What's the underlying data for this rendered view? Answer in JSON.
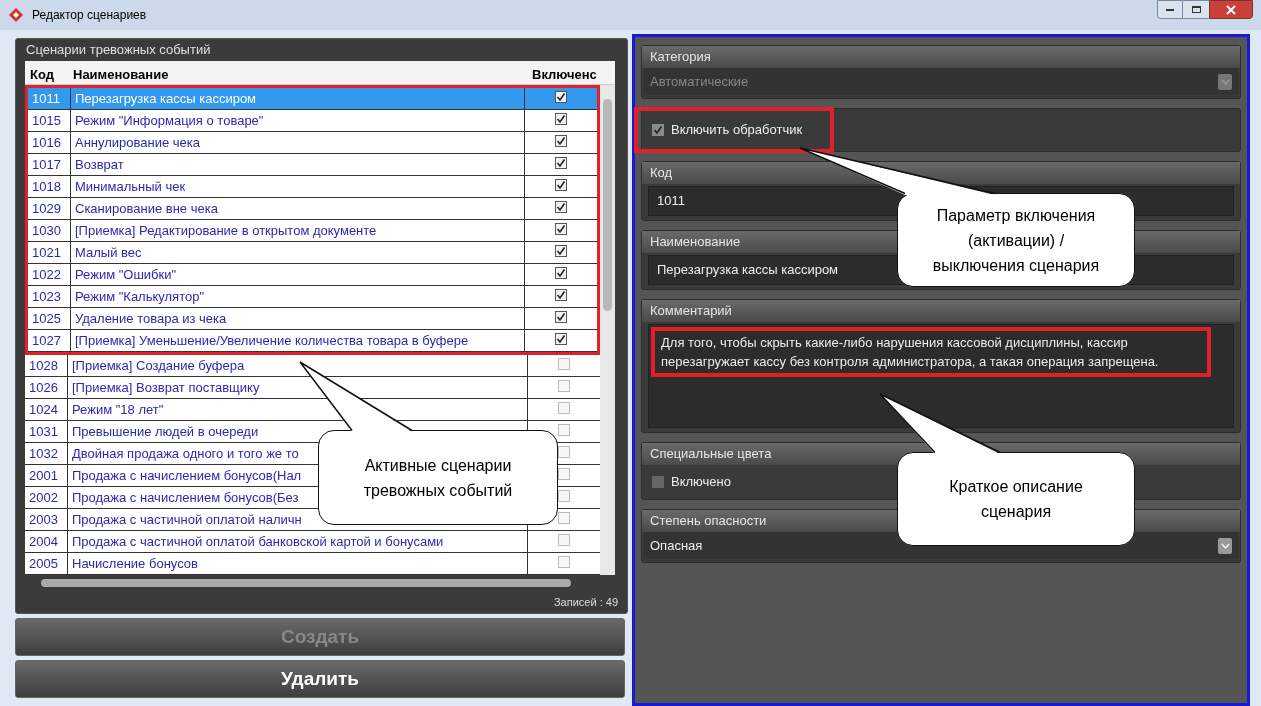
{
  "window": {
    "title": "Редактор сценариев"
  },
  "scenarios": {
    "title": "Сценарии тревожных событий",
    "columns": [
      "Код",
      "Наименование",
      "Включенс"
    ],
    "rows": [
      {
        "code": "1011",
        "name": "Перезагрузка кассы кассиром",
        "enabled": true,
        "selected": true
      },
      {
        "code": "1015",
        "name": "Режим \"Информация о товаре\"",
        "enabled": true,
        "selected": false
      },
      {
        "code": "1016",
        "name": "Аннулирование чека",
        "enabled": true,
        "selected": false
      },
      {
        "code": "1017",
        "name": "Возврат",
        "enabled": true,
        "selected": false
      },
      {
        "code": "1018",
        "name": "Минимальный чек",
        "enabled": true,
        "selected": false
      },
      {
        "code": "1029",
        "name": "Сканирование вне чека",
        "enabled": true,
        "selected": false
      },
      {
        "code": "1030",
        "name": "[Приемка] Редактирование в открытом документе",
        "enabled": true,
        "selected": false
      },
      {
        "code": "1021",
        "name": "Малый вес",
        "enabled": true,
        "selected": false
      },
      {
        "code": "1022",
        "name": "Режим \"Ошибки\"",
        "enabled": true,
        "selected": false
      },
      {
        "code": "1023",
        "name": "Режим \"Калькулятор\"",
        "enabled": true,
        "selected": false
      },
      {
        "code": "1025",
        "name": "Удаление товара из чека",
        "enabled": true,
        "selected": false
      },
      {
        "code": "1027",
        "name": "[Приемка] Уменьшение/Увеличение количества товара в буфере",
        "enabled": true,
        "selected": false
      },
      {
        "code": "1028",
        "name": "[Приемка] Создание буфера",
        "enabled": false,
        "selected": false
      },
      {
        "code": "1026",
        "name": "[Приемка] Возврат поставщику",
        "enabled": false,
        "selected": false
      },
      {
        "code": "1024",
        "name": "Режим \"18 лет\"",
        "enabled": false,
        "selected": false
      },
      {
        "code": "1031",
        "name": "Превышение людей в очереди",
        "enabled": false,
        "selected": false
      },
      {
        "code": "1032",
        "name": "Двойная продажа одного и того же то",
        "enabled": false,
        "selected": false
      },
      {
        "code": "2001",
        "name": "Продажа с начислением бонусов(Нал",
        "enabled": false,
        "selected": false
      },
      {
        "code": "2002",
        "name": "Продажа с начислением бонусов(Без",
        "enabled": false,
        "selected": false
      },
      {
        "code": "2003",
        "name": "Продажа с частичной оплатой наличн",
        "enabled": false,
        "selected": false
      },
      {
        "code": "2004",
        "name": "Продажа с частичной оплатой банковской картой и бонусами",
        "enabled": false,
        "selected": false
      },
      {
        "code": "2005",
        "name": "Начисление бонусов",
        "enabled": false,
        "selected": false
      }
    ],
    "records": "Записей : 49"
  },
  "buttons": [
    {
      "label": "Создать",
      "disabled": true
    },
    {
      "label": "Удалить",
      "disabled": false
    }
  ],
  "details": {
    "category": {
      "label": "Категория",
      "value": "Автоматические",
      "disabled": true
    },
    "handler": {
      "label": "Включить обработчик",
      "checked": true
    },
    "code": {
      "label": "Код",
      "value": "1011"
    },
    "name": {
      "label": "Наименование",
      "value": "Перезагрузка кассы кассиром"
    },
    "comment": {
      "label": "Комментарий",
      "value": "Для того, чтобы скрыть какие-либо нарушения кассовой дисциплины, кассир перезагружает кассу без контроля администратора, а такая операция запрещена."
    },
    "special_colors": {
      "label": "Специальные цвета",
      "checkbox": "Включено",
      "checked": false
    },
    "danger": {
      "label": "Степень опасности",
      "value": "Опасная",
      "disabled": false
    }
  },
  "callouts": [
    "Активные сценарии тревожных событий",
    "Параметр включения (активации) / выключения сценария",
    "Краткое описание сценария"
  ]
}
